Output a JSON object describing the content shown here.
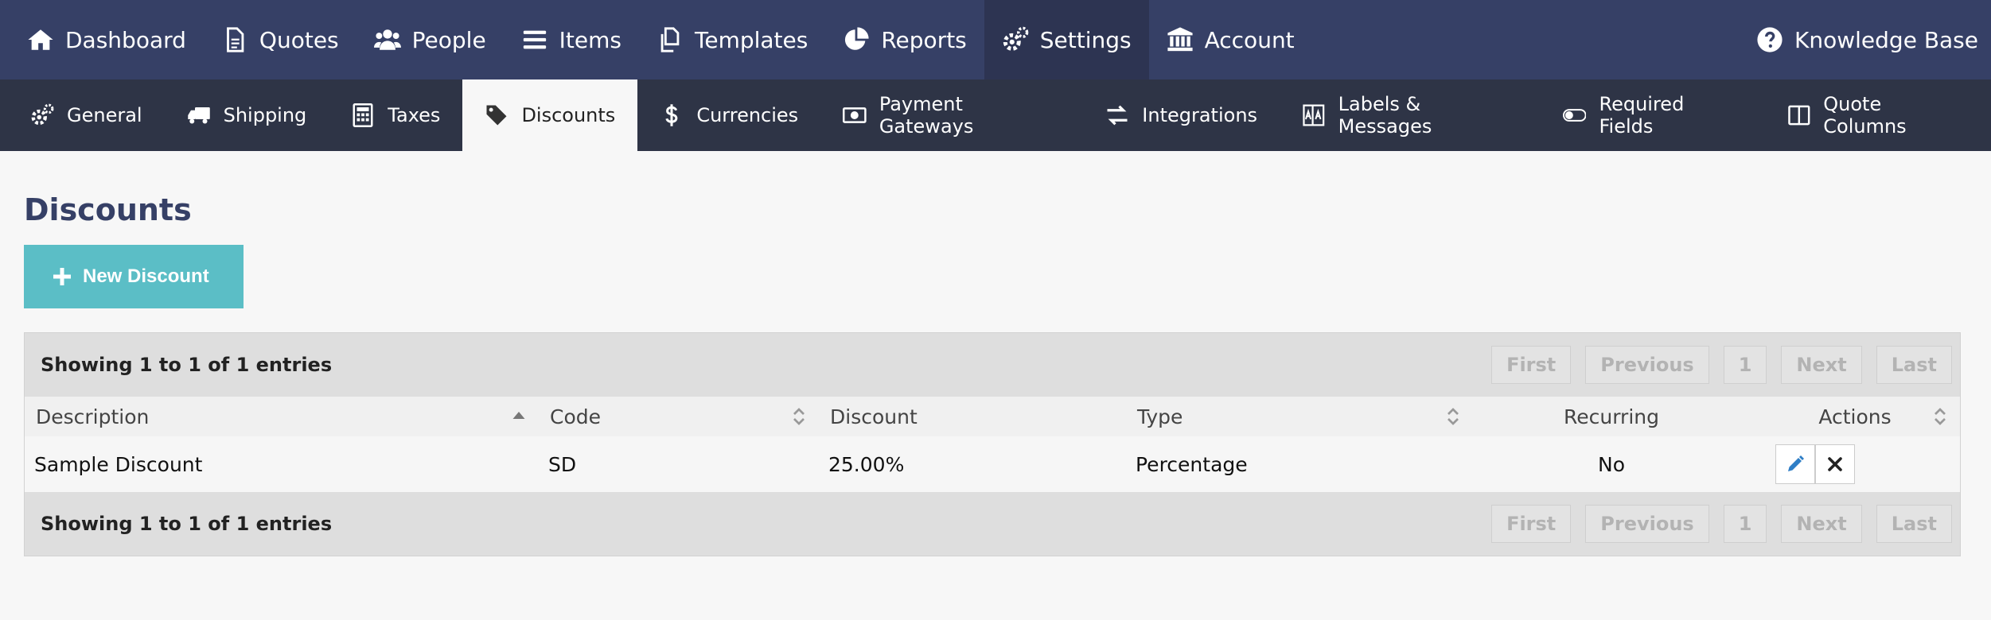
{
  "topnav": {
    "items": [
      {
        "label": "Dashboard",
        "icon": "home-icon"
      },
      {
        "label": "Quotes",
        "icon": "document-icon"
      },
      {
        "label": "People",
        "icon": "users-icon"
      },
      {
        "label": "Items",
        "icon": "list-icon"
      },
      {
        "label": "Templates",
        "icon": "copy-icon"
      },
      {
        "label": "Reports",
        "icon": "pie-chart-icon"
      },
      {
        "label": "Settings",
        "icon": "gears-icon",
        "active": true
      },
      {
        "label": "Account",
        "icon": "bank-icon"
      }
    ],
    "knowledge_base": {
      "label": "Knowledge Base",
      "icon": "question-circle-icon"
    }
  },
  "subnav": {
    "items": [
      {
        "label": "General",
        "icon": "gears-icon"
      },
      {
        "label": "Shipping",
        "icon": "truck-icon"
      },
      {
        "label": "Taxes",
        "icon": "calculator-icon"
      },
      {
        "label": "Discounts",
        "icon": "tag-icon",
        "active": true
      },
      {
        "label": "Currencies",
        "icon": "dollar-icon"
      },
      {
        "label": "Payment Gateways",
        "icon": "money-icon"
      },
      {
        "label": "Integrations",
        "icon": "exchange-icon"
      },
      {
        "label": "Labels & Messages",
        "icon": "language-icon"
      },
      {
        "label": "Required Fields",
        "icon": "toggle-icon"
      },
      {
        "label": "Quote Columns",
        "icon": "columns-icon"
      }
    ]
  },
  "page": {
    "title": "Discounts",
    "new_button": "New Discount"
  },
  "table": {
    "info_top": "Showing 1 to 1 of 1 entries",
    "info_bottom": "Showing 1 to 1 of 1 entries",
    "pager": {
      "first": "First",
      "previous": "Previous",
      "page": "1",
      "next": "Next",
      "last": "Last"
    },
    "columns": {
      "description": "Description",
      "code": "Code",
      "discount": "Discount",
      "type": "Type",
      "recurring": "Recurring",
      "actions": "Actions"
    },
    "rows": [
      {
        "description": "Sample Discount",
        "code": "SD",
        "discount": "25.00%",
        "type": "Percentage",
        "recurring": "No"
      }
    ]
  },
  "colors": {
    "topnav_bg": "#364066",
    "subnav_bg": "#2e3446",
    "accent_button": "#5bbec6",
    "title": "#364066",
    "edit_icon": "#2f7ec6"
  }
}
